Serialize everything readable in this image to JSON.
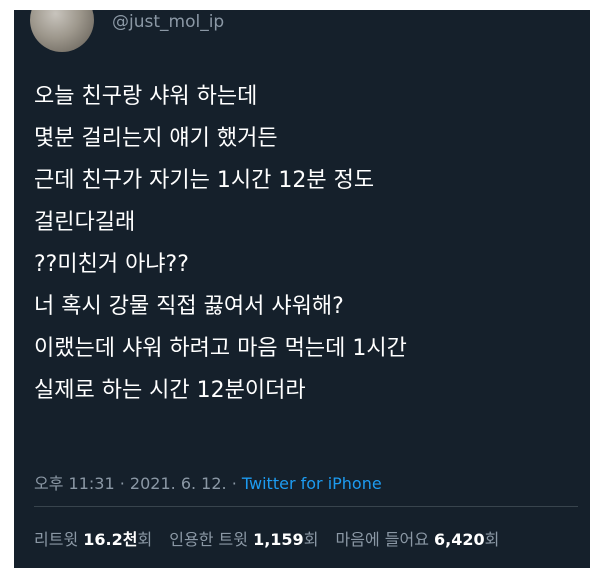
{
  "author": {
    "handle": "@just_mol_ip"
  },
  "tweet": {
    "lines": [
      "오늘 친구랑 샤워 하는데",
      "몇분 걸리는지 얘기 했거든",
      "근데 친구가 자기는 1시간 12분 정도",
      "걸린다길래",
      "??미친거 아냐??",
      "너 혹시 강물 직접 끓여서 샤워해?",
      "이랬는데 샤워 하려고 마음 먹는데 1시간",
      "실제로 하는 시간 12분이더라"
    ]
  },
  "meta": {
    "time": "오후 11:31",
    "separator": "·",
    "date": "2021. 6. 12.",
    "source": "Twitter for iPhone"
  },
  "stats": {
    "retweets": {
      "label": "리트윗",
      "value": "16.2천",
      "unit": "회"
    },
    "quotes": {
      "label": "인용한 트윗",
      "value": "1,159",
      "unit": "회"
    },
    "likes": {
      "label": "마음에 들어요",
      "value": "6,420",
      "unit": "회"
    }
  },
  "colors": {
    "background": "#15202b",
    "text": "#ffffff",
    "muted": "#8b98a5",
    "link": "#1d9bf0"
  }
}
